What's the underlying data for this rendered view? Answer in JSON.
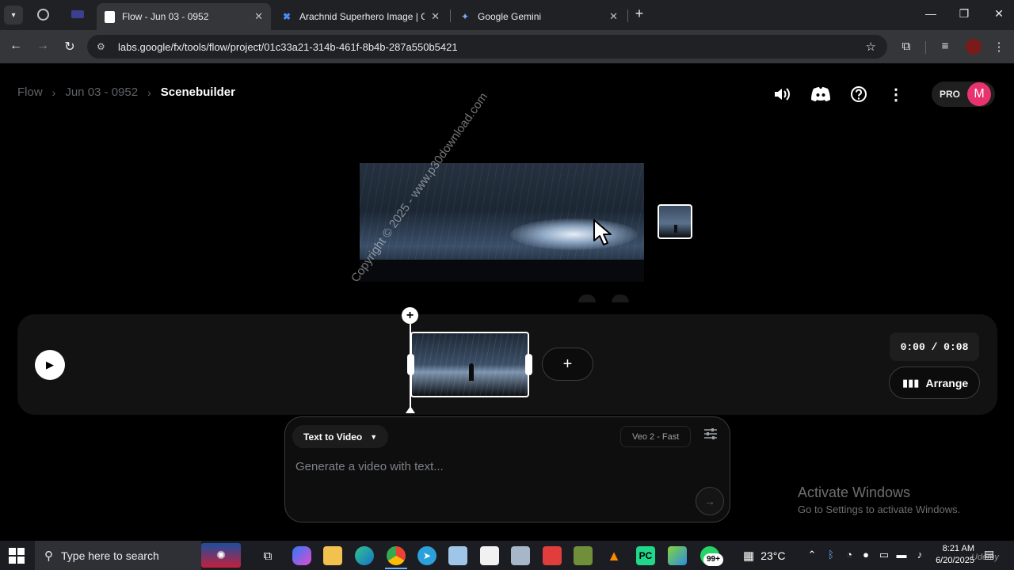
{
  "browser": {
    "tabs": [
      {
        "title": "Flow - Jun 03 - 0952",
        "active": true
      },
      {
        "title": "Arachnid Superhero Image | Go",
        "active": false
      },
      {
        "title": "Google Gemini",
        "active": false
      }
    ],
    "url": "labs.google/fx/tools/flow/project/01c33a21-314b-461f-8b4b-287a550b5421"
  },
  "header": {
    "breadcrumb": [
      "Flow",
      "Jun 03 - 0952",
      "Scenebuilder"
    ],
    "plan_badge": "PRO",
    "avatar_initial": "M"
  },
  "timeline": {
    "timecode": "0:00 / 0:08",
    "arrange_label": "Arrange"
  },
  "composer": {
    "mode_label": "Text to Video",
    "model_label": "Veo 2 - Fast",
    "placeholder": "Generate a video with text..."
  },
  "overlay": {
    "watermark": "Copyright © 2025 - www.p30download.com",
    "activate_title": "Activate Windows",
    "activate_sub": "Go to Settings to activate Windows.",
    "corner_watermark": "Udemy"
  },
  "taskbar": {
    "search_placeholder": "Type here to search",
    "notification_badge": "99+",
    "temperature": "23°C",
    "time": "8:21 AM",
    "date": "6/20/2025"
  },
  "colors": {
    "accent_avatar": "#e8336f",
    "page_bg": "#000000",
    "panel_bg": "#121212"
  }
}
